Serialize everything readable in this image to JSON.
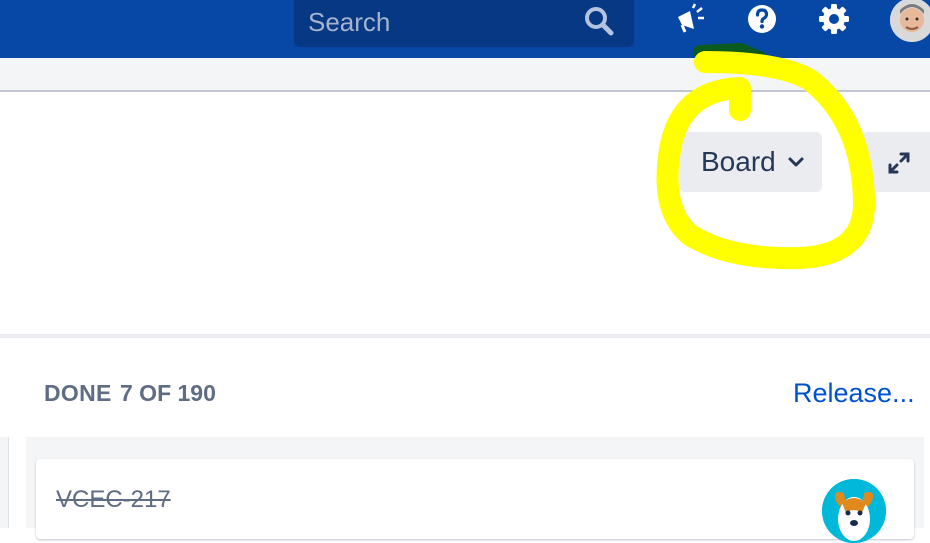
{
  "topbar": {
    "search": {
      "placeholder": "Search"
    },
    "icons": [
      "search-icon",
      "megaphone-icon",
      "help-icon",
      "gear-icon",
      "avatar"
    ],
    "colors": {
      "bar": "#0747A6",
      "search_bg": "#073884"
    }
  },
  "board_controls": {
    "view_label": "Board",
    "view_icon": "chevron-down-icon",
    "expand_icon": "expand-icon"
  },
  "column": {
    "title": "DONE",
    "count": "7 OF 190",
    "release_link": "Release..."
  },
  "cards": [
    {
      "key": "VCEC-217",
      "status": "done",
      "assignee_icon": "dog-avatar"
    }
  ],
  "annotation": {
    "color": "#FFFF00"
  }
}
